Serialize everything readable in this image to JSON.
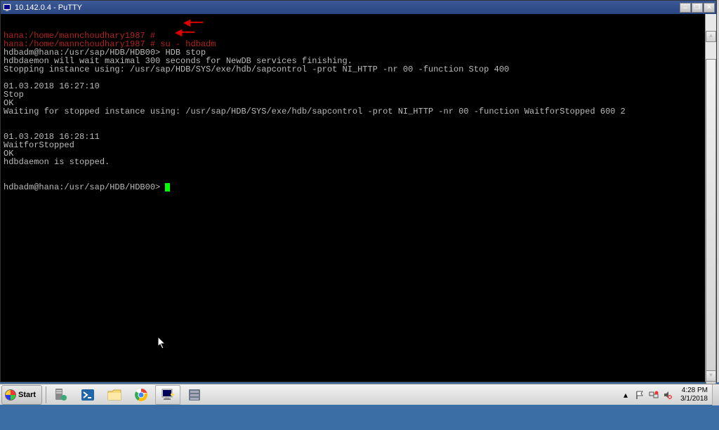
{
  "window": {
    "title": "10.142.0.4 - PuTTY"
  },
  "terminal": {
    "lines": [
      {
        "text": "hana:/home/mannchoudhary1987 #",
        "cls": "red-text"
      },
      {
        "text": "hana:/home/mannchoudhary1987 # su - hdbadm",
        "cls": "red-text"
      },
      {
        "text": "hdbadm@hana:/usr/sap/HDB/HDB00> HDB stop",
        "cls": ""
      },
      {
        "text": "hdbdaemon will wait maximal 300 seconds for NewDB services finishing.",
        "cls": ""
      },
      {
        "text": "Stopping instance using: /usr/sap/HDB/SYS/exe/hdb/sapcontrol -prot NI_HTTP -nr 00 -function Stop 400",
        "cls": ""
      },
      {
        "text": "",
        "cls": ""
      },
      {
        "text": "01.03.2018 16:27:10",
        "cls": ""
      },
      {
        "text": "Stop",
        "cls": ""
      },
      {
        "text": "OK",
        "cls": ""
      },
      {
        "text": "Waiting for stopped instance using: /usr/sap/HDB/SYS/exe/hdb/sapcontrol -prot NI_HTTP -nr 00 -function WaitforStopped 600 2",
        "cls": ""
      },
      {
        "text": "",
        "cls": ""
      },
      {
        "text": "",
        "cls": ""
      },
      {
        "text": "01.03.2018 16:28:11",
        "cls": ""
      },
      {
        "text": "WaitforStopped",
        "cls": ""
      },
      {
        "text": "OK",
        "cls": ""
      },
      {
        "text": "hdbdaemon is stopped.",
        "cls": ""
      }
    ],
    "prompt": "hdbadm@hana:/usr/sap/HDB/HDB00> "
  },
  "taskbar": {
    "start": "Start",
    "time": "4:28 PM",
    "date": "3/1/2018"
  },
  "icons": {
    "server": "🖥",
    "powershell": "▶",
    "explorer": "📁",
    "chrome": "⬤",
    "putty": "🖳",
    "servermgr": "⚙"
  }
}
